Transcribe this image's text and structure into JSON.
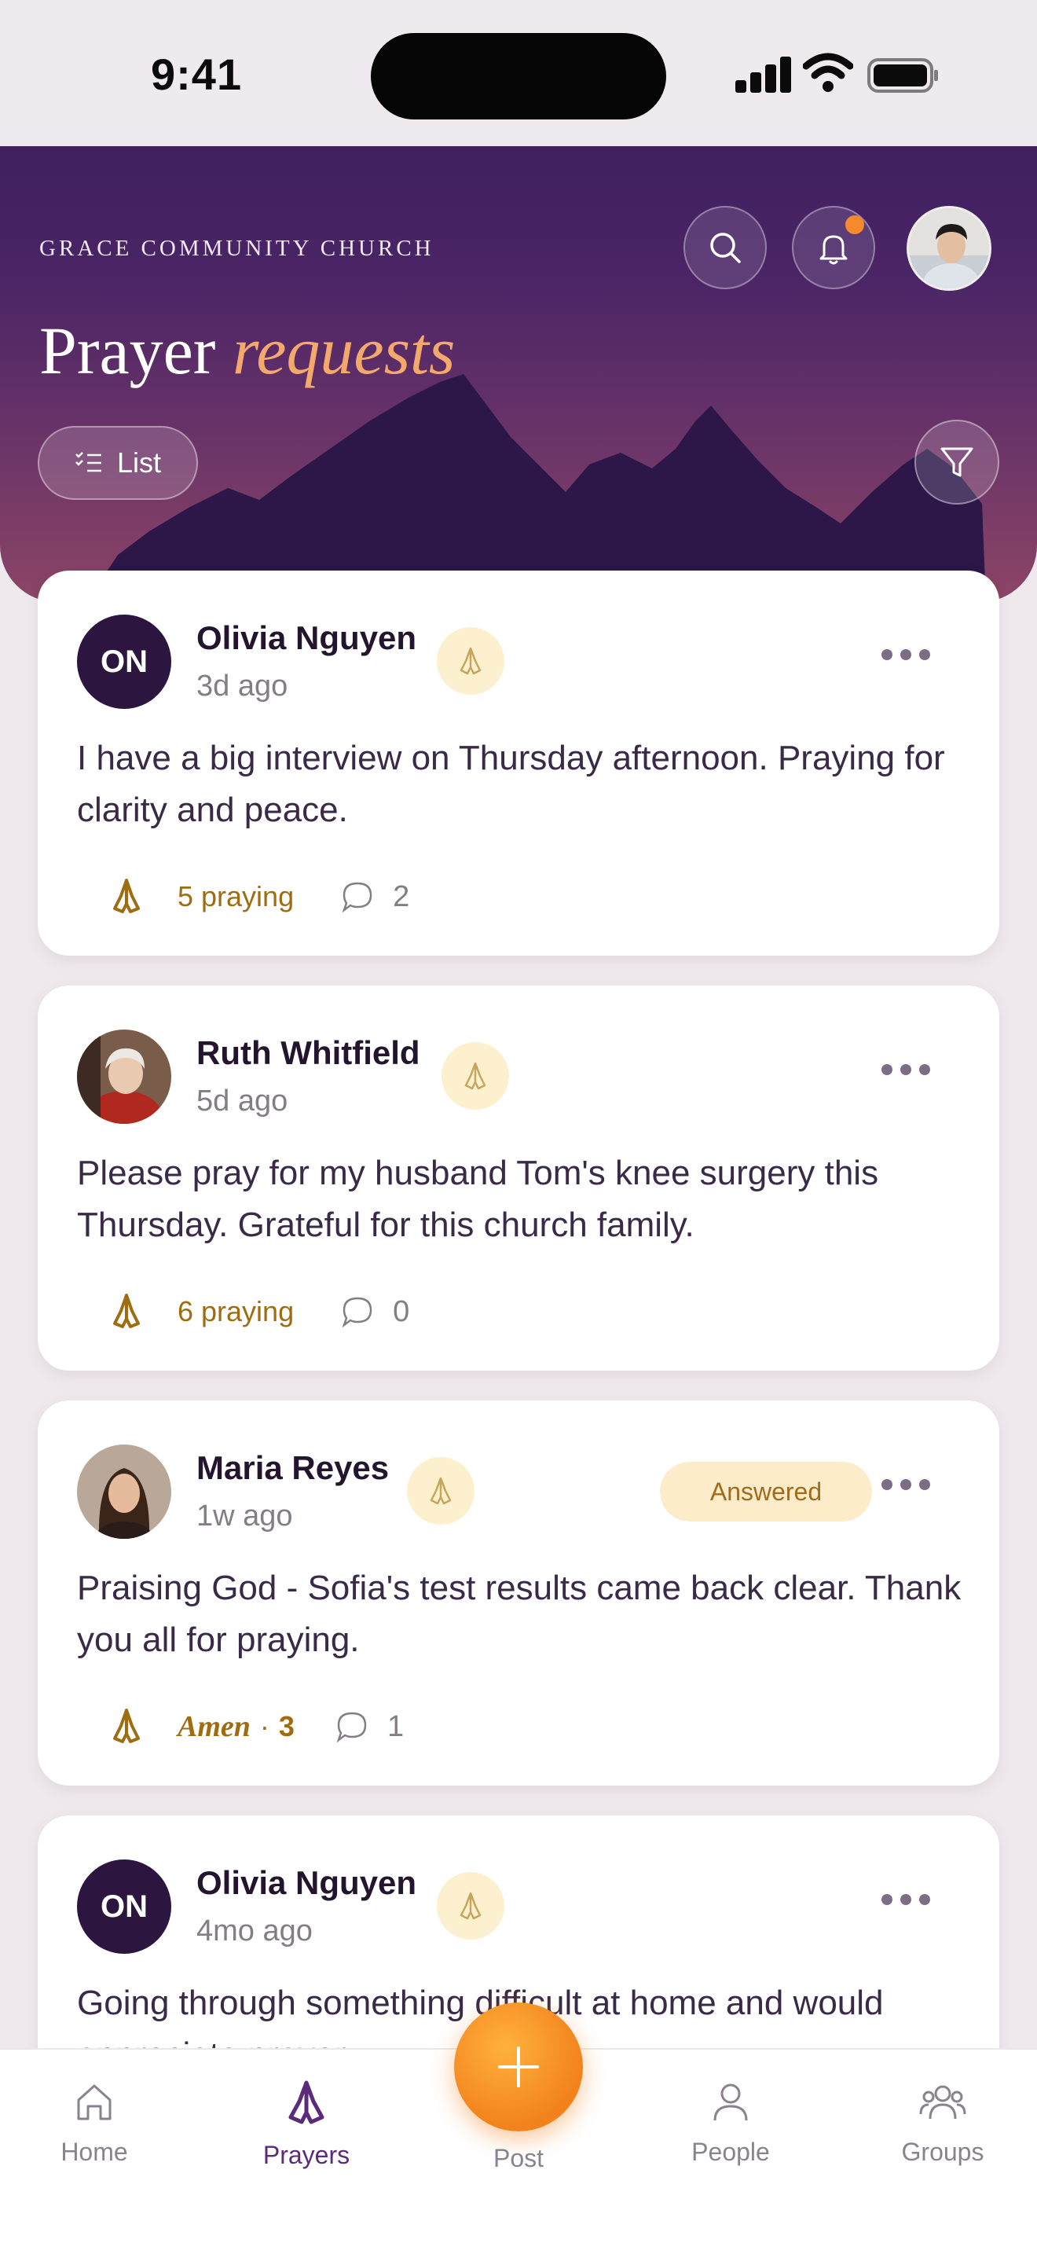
{
  "status_bar": {
    "time": "9:41"
  },
  "header": {
    "church_name": "GRACE COMMUNITY CHURCH",
    "title_main": "Prayer",
    "title_accent": "requests",
    "list_button_label": "List",
    "colors": {
      "accent": "#f2a96b",
      "notification": "#f58a2c"
    },
    "icons": [
      "search-icon",
      "bell-icon",
      "list-icon",
      "filter-icon"
    ]
  },
  "posts": [
    {
      "author": "Olivia Nguyen",
      "initials": "ON",
      "time": "3d ago",
      "text": "I have a big interview on Thursday afternoon. Praying for clarity and peace.",
      "praying_label": "5 praying",
      "comments": "2"
    },
    {
      "author": "Ruth Whitfield",
      "time": "5d ago",
      "text": "Please pray for my husband Tom's knee surgery this Thursday. Grateful for this church family.",
      "praying_label": "6 praying",
      "comments": "0"
    },
    {
      "author": "Maria Reyes",
      "time": "1w ago",
      "badge": "Answered",
      "text": "Praising God - Sofia's test results came back clear. Thank you all for praying.",
      "amen_label": "Amen",
      "amen_count": "3",
      "comments": "1"
    },
    {
      "author": "Olivia Nguyen",
      "initials": "ON",
      "time": "4mo ago",
      "text": "Going through something difficult at home and would appreciate prayer."
    }
  ],
  "nav": {
    "home": "Home",
    "prayers": "Prayers",
    "post": "Post",
    "people": "People",
    "groups": "Groups",
    "active": "prayers",
    "colors": {
      "active": "#5b2a7a",
      "fab": "#f2821c"
    }
  }
}
